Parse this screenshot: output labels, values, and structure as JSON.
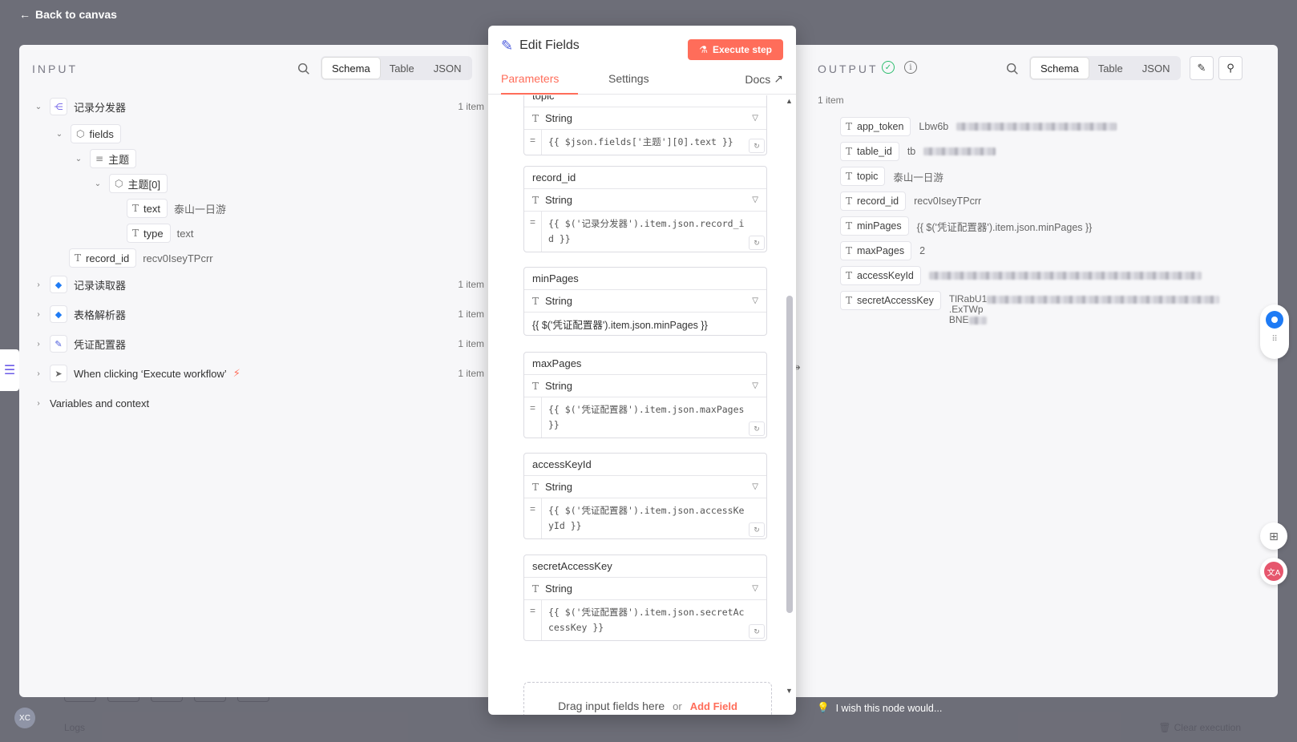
{
  "background": {
    "back_label": "Back to canvas",
    "avatar_initials": "XC",
    "logs_label": "Logs",
    "clear_label": "Clear execution"
  },
  "input": {
    "title": "INPUT",
    "view_tabs": [
      "Schema",
      "Table",
      "JSON"
    ],
    "active_view": "Schema",
    "tree": {
      "node1": {
        "label": "记录分发器",
        "count": "1 item"
      },
      "fields_label": "fields",
      "topic_group": "主题",
      "topic_item": "主题[0]",
      "text_key": "text",
      "text_val": "泰山一日游",
      "type_key": "type",
      "type_val": "text",
      "record_key": "record_id",
      "record_val": "recv0IseyTPcrr",
      "node2": {
        "label": "记录读取器",
        "count": "1 item"
      },
      "node3": {
        "label": "表格解析器",
        "count": "1 item"
      },
      "node4": {
        "label": "凭证配置器",
        "count": "1 item"
      },
      "node5": {
        "label": "When clicking ‘Execute workflow’",
        "count": "1 item"
      },
      "variables": "Variables and context"
    }
  },
  "modal": {
    "title": "Edit Fields",
    "execute_label": "Execute step",
    "tabs": {
      "parameters": "Parameters",
      "settings": "Settings",
      "docs": "Docs"
    },
    "fields": [
      {
        "name": "topic",
        "type": "String",
        "value": "{{ $json.fields['主题'][0].text }}"
      },
      {
        "name": "record_id",
        "type": "String",
        "value": "{{ $('记录分发器').item.json.record_id }}"
      },
      {
        "name": "minPages",
        "type": "String",
        "value": "{{ $('凭证配置器').item.json.minPages }}"
      },
      {
        "name": "maxPages",
        "type": "String",
        "value": "{{ $('凭证配置器').item.json.maxPages }}"
      },
      {
        "name": "accessKeyId",
        "type": "String",
        "value": "{{ $('凭证配置器').item.json.accessKeyId }}"
      },
      {
        "name": "secretAccessKey",
        "type": "String",
        "value": "{{ $('凭证配置器').item.json.secretAccessKey }}"
      }
    ],
    "drop_text": "Drag input fields here",
    "drop_or": "or",
    "add_field": "Add Field"
  },
  "output": {
    "title": "OUTPUT",
    "view_tabs": [
      "Schema",
      "Table",
      "JSON"
    ],
    "active_view": "Schema",
    "items_count": "1 item",
    "rows": [
      {
        "key": "app_token",
        "value": "Lbw6b"
      },
      {
        "key": "table_id",
        "value": "tb"
      },
      {
        "key": "topic",
        "value": "泰山一日游"
      },
      {
        "key": "record_id",
        "value": "recv0IseyTPcrr"
      },
      {
        "key": "minPages",
        "value": "{{ $('凭证配置器').item.json.minPages }}"
      },
      {
        "key": "maxPages",
        "value": "2"
      },
      {
        "key": "accessKeyId",
        "value": ""
      },
      {
        "key": "secretAccessKey",
        "value": "TlRabU1",
        "value_tail": ".ExTWp",
        "value_line2": "BNE"
      }
    ],
    "hint": "I wish this node would..."
  },
  "colors": {
    "accent": "#ff6d5a",
    "success": "#2dbd6e",
    "brand_purple": "#6c5ce7"
  }
}
